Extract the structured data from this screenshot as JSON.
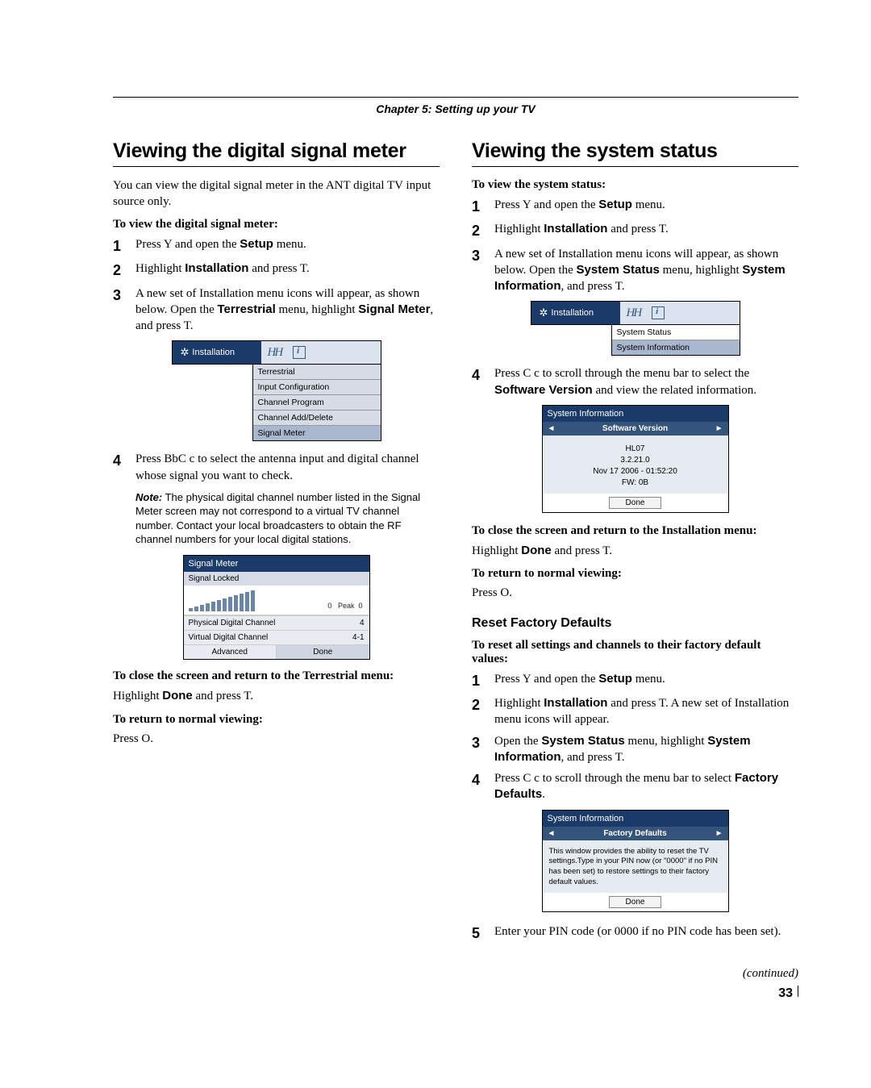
{
  "chapter": "Chapter 5: Setting up your TV",
  "left": {
    "title": "Viewing the digital signal meter",
    "intro": "You can view the digital signal meter in the ANT digital TV input source only.",
    "sub1": "To view the digital signal meter:",
    "steps": [
      {
        "n": "1",
        "text_before": "Press ",
        "key": "Y",
        "text_after": " and open the ",
        "bold": "Setup",
        "tail": " menu."
      },
      {
        "n": "2",
        "text_before": "Highlight ",
        "bold": "Installation",
        "text_after": " and press ",
        "key": "T",
        "tail": "."
      },
      {
        "n": "3",
        "text_before": "A new set of Installation menu icons will appear, as shown below. Open the ",
        "bold": "Terrestrial",
        "text_after": " menu, highlight ",
        "bold2": "Signal Meter",
        "tail2": ", and press ",
        "key": "T",
        "tail": "."
      }
    ],
    "menu": {
      "title": "Installation",
      "items": [
        "Terrestrial",
        "Input Configuration",
        "Channel Program",
        "Channel Add/Delete",
        "Signal Meter"
      ],
      "hl": 4
    },
    "step4": {
      "n": "4",
      "text": "Press BbC c to select the antenna input and digital channel whose signal you want to check."
    },
    "note_label": "Note:",
    "note": " The physical digital channel number listed in the Signal Meter screen may not correspond to a virtual TV channel number. Contact your local broadcasters to obtain the RF channel numbers for your local digital stations.",
    "signal_meter": {
      "title": "Signal Meter",
      "sub": "Signal Locked",
      "current": "0",
      "peak_label": "Peak",
      "peak": "0",
      "rows": [
        [
          "Physical Digital Channel",
          "4"
        ],
        [
          "Virtual Digital Channel",
          "4-1"
        ]
      ],
      "btns": [
        "Advanced",
        "Done"
      ]
    },
    "close_head": "To close the screen and return to the Terrestrial menu:",
    "close_body_pre": "Highlight ",
    "close_bold": "Done",
    "close_body_mid": " and press ",
    "close_key": "T",
    "close_body_post": ".",
    "return_head": "To return to normal viewing:",
    "return_body": "Press O."
  },
  "right": {
    "title": "Viewing the system status",
    "sub1": "To view the system status:",
    "steps": [
      {
        "n": "1",
        "text_before": "Press ",
        "key": "Y",
        "text_after": " and open the ",
        "bold": "Setup",
        "tail": " menu."
      },
      {
        "n": "2",
        "text_before": "Highlight ",
        "bold": "Installation",
        "text_after": " and press ",
        "key": "T",
        "tail": "."
      },
      {
        "n": "3",
        "text_before": "A new set of Installation menu icons will appear, as shown below. Open the ",
        "bold": "System Status",
        "text_after": " menu, highlight ",
        "bold2": "System Information",
        "tail2": ", and press ",
        "key": "T",
        "tail": "."
      }
    ],
    "menu": {
      "title": "Installation",
      "items": [
        "System Status",
        "System Information"
      ],
      "hl": 1
    },
    "step4": {
      "n": "4",
      "pre": "Press C c to scroll through the menu bar to select the ",
      "bold": "Software Version",
      "post": " and view the related information."
    },
    "sys_info": {
      "title": "System Information",
      "bar": "Software Version",
      "lines": [
        "HL07",
        "3.2.21.0",
        "Nov 17 2006 - 01:52:20",
        "FW:  0B"
      ],
      "done": "Done"
    },
    "close_head": "To close the screen and return to the Installation menu:",
    "close_body_pre": "Highlight ",
    "close_bold": "Done",
    "close_body_mid": " and press ",
    "close_key": "T",
    "close_body_post": ".",
    "return_head": "To return to normal viewing:",
    "return_body": "Press O.",
    "subsection": "Reset Factory Defaults",
    "reset_head": "To reset all settings and channels to their factory default values:",
    "reset_steps": [
      {
        "n": "1",
        "text_before": "Press ",
        "key": "Y",
        "text_after": " and open the ",
        "bold": "Setup",
        "tail": " menu."
      },
      {
        "n": "2",
        "text_before": "Highlight ",
        "bold": "Installation",
        "text_after": " and press ",
        "key": "T",
        "tail": ". A new set of Installation menu icons will appear."
      },
      {
        "n": "3",
        "text_before": "Open the ",
        "bold": "System Status",
        "text_after": " menu, highlight ",
        "bold2": "System Information",
        "tail2": ", and press ",
        "key": "T",
        "tail": "."
      },
      {
        "n": "4",
        "pre": "Press C c to scroll through the menu bar to select ",
        "bold": "Factory Defaults",
        "post": "."
      }
    ],
    "fd_box": {
      "title": "System Information",
      "bar": "Factory Defaults",
      "body": "This window provides the ability to reset the TV settings.Type in your PIN now  (or \"0000\"  if no PIN has been set) to restore settings to their factory default values.",
      "done": "Done"
    },
    "step5": {
      "n": "5",
      "text": "Enter your PIN code (or 0000 if no PIN code has been set)."
    },
    "continued": "(continued)",
    "page": "33"
  }
}
